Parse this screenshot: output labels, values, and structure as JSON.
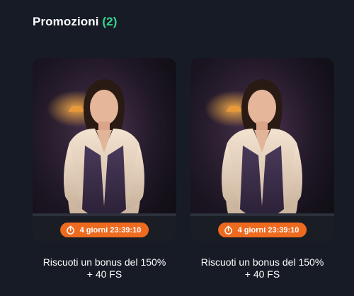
{
  "section": {
    "title": "Promozioni",
    "count": "(2)"
  },
  "promotions": [
    {
      "timer": "4 giorni 23:39:10",
      "title_line1": "Riscuoti un bonus del 150%",
      "title_line2": "+ 40 FS",
      "icon": "stopwatch-icon"
    },
    {
      "timer": "4 giorni 23:39:10",
      "title_line1": "Riscuoti un bonus del 150%",
      "title_line2": "+ 40 FS",
      "icon": "stopwatch-icon"
    }
  ],
  "colors": {
    "background": "#171b26",
    "accent_green": "#35d48f",
    "badge_orange": "#ee6a1f",
    "text": "#ffffff"
  }
}
